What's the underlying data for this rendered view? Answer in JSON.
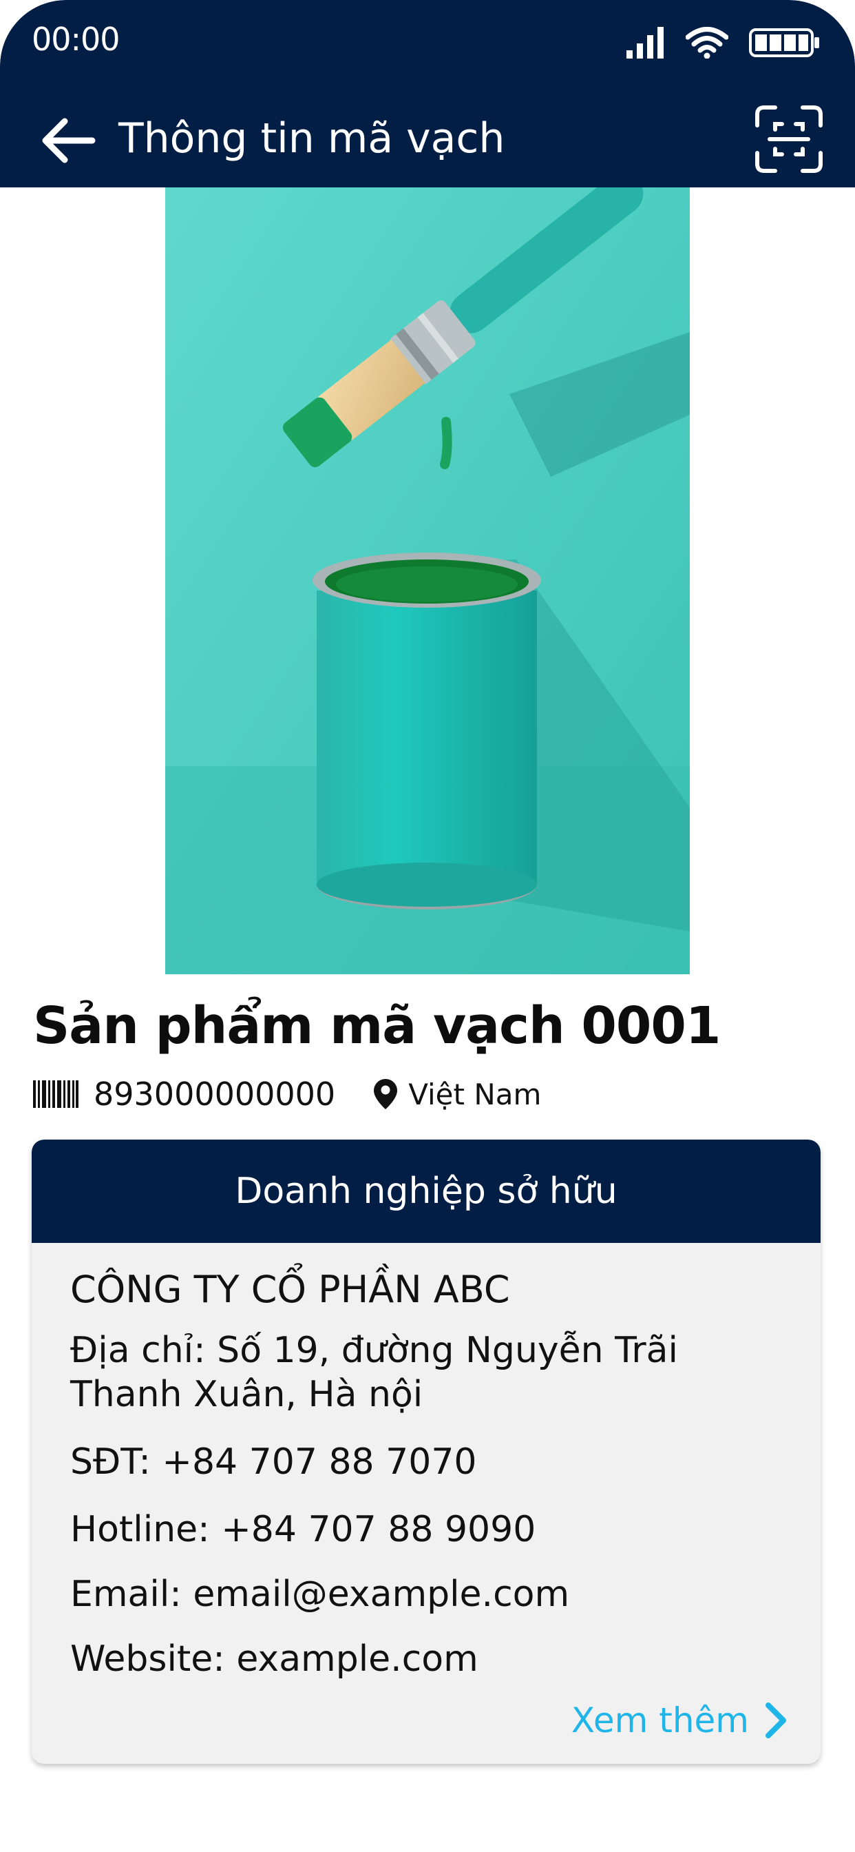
{
  "status_bar": {
    "time": "00:00"
  },
  "header": {
    "title": "Thông tin mã vạch"
  },
  "product": {
    "name": "Sản phẩm mã vạch 0001",
    "barcode": "893000000000",
    "origin": "Việt Nam"
  },
  "owner_card": {
    "heading": "Doanh nghiệp sở hữu",
    "company": "CÔNG TY CỔ PHẦN ABC",
    "address_line1": "Địa chỉ: Số 19, đường Nguyễn Trãi",
    "address_line2": "Thanh Xuân, Hà nội",
    "phone": "SĐT: +84 707 88 7070",
    "hotline": "Hotline: +84 707 88 9090",
    "email": "Email: email@example.com",
    "website": "Website: example.com",
    "see_more": "Xem thêm"
  },
  "colors": {
    "header_bg": "#031e45",
    "card_bg": "#f1f1f1",
    "link": "#1fb5e8",
    "image_bg": "#4fd1c5"
  },
  "icons": [
    "signal-icon",
    "wifi-icon",
    "battery-icon",
    "back-arrow-icon",
    "scan-icon",
    "barcode-icon",
    "location-pin-icon",
    "chevron-right-icon"
  ]
}
